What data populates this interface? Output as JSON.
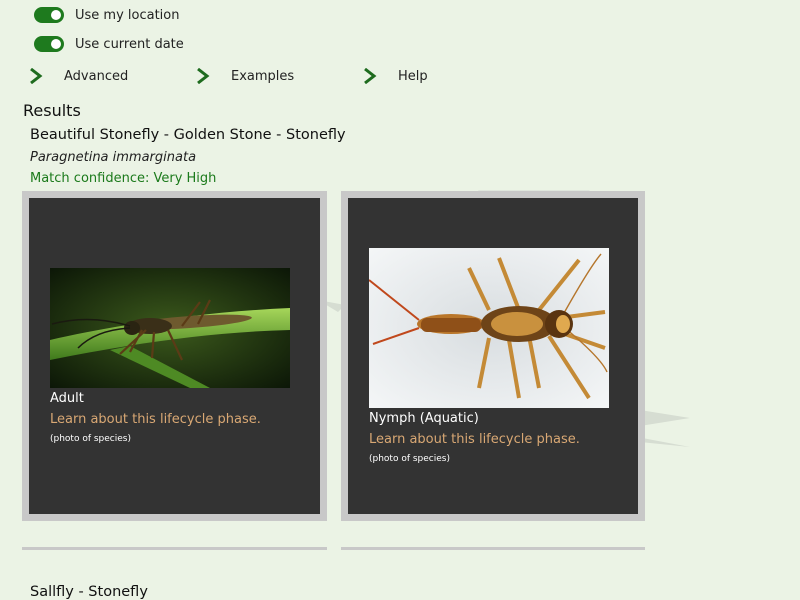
{
  "settings": {
    "use_location": {
      "label": "Use my location",
      "on": true
    },
    "use_date": {
      "label": "Use current date",
      "on": true
    }
  },
  "expanders": [
    {
      "label": "Advanced",
      "icon": "chevron-right-icon"
    },
    {
      "label": "Examples",
      "icon": "chevron-right-icon"
    },
    {
      "label": "Help",
      "icon": "chevron-right-icon"
    }
  ],
  "results": {
    "title": "Results",
    "items": [
      {
        "common_name": "Beautiful Stonefly - Golden Stone - Stonefly",
        "scientific_name": "Paragnetina immarginata",
        "confidence": "Match confidence: Very High",
        "phases": [
          {
            "label": "Adult",
            "link": "Learn about this lifecycle phase.",
            "credit": "(photo of species)"
          },
          {
            "label": "Nymph (Aquatic)",
            "link": "Learn about this lifecycle phase.",
            "credit": "(photo of species)"
          }
        ]
      },
      {
        "common_name": "Sallfly - Stonefly"
      }
    ]
  },
  "colors": {
    "background": "#ebf3e5",
    "toggle_on": "#1e7a1e",
    "accent_green": "#1b7a1b",
    "card_bg": "#333333",
    "card_border": "#c8c8c8",
    "link": "#d9a874"
  }
}
